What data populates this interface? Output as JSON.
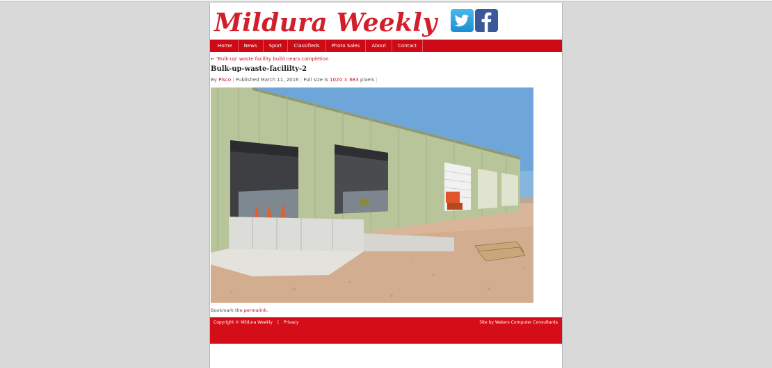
{
  "site": {
    "title": "Mildura Weekly",
    "social": [
      {
        "name": "twitter-icon"
      },
      {
        "name": "facebook-icon"
      }
    ]
  },
  "nav": {
    "items": [
      "Home",
      "News",
      "Sport",
      "Classifieds",
      "Photo Sales",
      "About",
      "Contact"
    ]
  },
  "post": {
    "back_arrow": "←",
    "back_label": "'Bulk-up' waste facility build nears completion",
    "title": "Bulk-up-waste-facililty-2",
    "by": "By",
    "author": "Pisco",
    "published": "Published March 11, 2016",
    "full_size_label": "Full size is",
    "width": "1024",
    "times": "×",
    "height": "683",
    "pixels": "pixels",
    "bookmark_text": "Bookmark the",
    "permalink": "permalink",
    "period": "."
  },
  "footer": {
    "copyright": "Copyright © Mildura Weekly",
    "divider": "|",
    "privacy": "Privacy",
    "credit": "Site by Waters Computer Consultants"
  },
  "colors": {
    "brand_red": "#d21f2c",
    "nav_red": "#cd0a15"
  }
}
